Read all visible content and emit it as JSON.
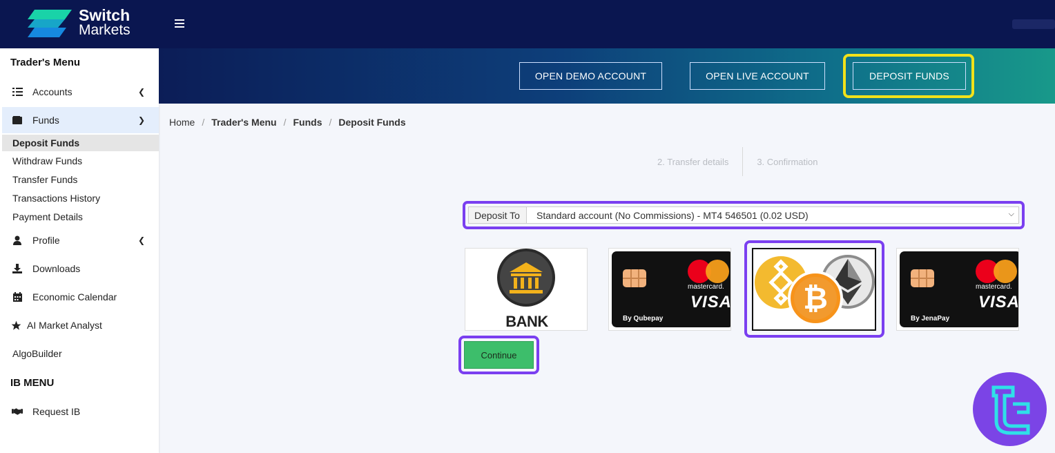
{
  "brand": {
    "line1": "Switch",
    "line2": "Markets",
    "colors": {
      "navy": "#0a1650",
      "accent_purple": "#7a3ff0",
      "highlight_yellow": "#f2e21a",
      "continue_green": "#3dbe6b"
    }
  },
  "sidebar": {
    "heading": "Trader's Menu",
    "accounts": {
      "label": "Accounts",
      "icon": "list-icon"
    },
    "funds": {
      "label": "Funds",
      "icon": "wallet-icon"
    },
    "funds_sub": [
      "Deposit Funds",
      "Withdraw Funds",
      "Transfer Funds",
      "Transactions History",
      "Payment Details"
    ],
    "profile": {
      "label": "Profile",
      "icon": "user-icon"
    },
    "downloads": {
      "label": "Downloads",
      "icon": "download-icon"
    },
    "calendar": {
      "label": "Economic Calendar",
      "icon": "calendar-icon"
    },
    "ai": {
      "label": "AI Market Analyst",
      "icon": "star-icon"
    },
    "algo": {
      "label": "AlgoBuilder"
    },
    "ib_heading": "IB MENU",
    "request_ib": {
      "label": "Request IB",
      "icon": "handshake-icon"
    }
  },
  "banner": {
    "demo": "OPEN DEMO ACCOUNT",
    "live": "OPEN LIVE ACCOUNT",
    "deposit": "DEPOSIT FUNDS"
  },
  "breadcrumb": [
    "Home",
    "Trader's Menu",
    "Funds",
    "Deposit Funds"
  ],
  "steps": [
    "2. Transfer details",
    "3. Confirmation"
  ],
  "deposit": {
    "label": "Deposit To",
    "selected": "Standard account (No Commissions) - MT4 546501 (0.02 USD)"
  },
  "methods": {
    "bank": {
      "label": "BANK TRANSFER"
    },
    "qubepay": {
      "brand": "mastercard.",
      "network": "VISA",
      "by": "By Qubepay"
    },
    "crypto": {
      "coins": [
        "binance-icon",
        "bitcoin-icon",
        "ethereum-icon"
      ]
    },
    "jenapay": {
      "brand": "mastercard.",
      "network": "VISA",
      "by": "By JenaPay"
    }
  },
  "continue_label": "Continue"
}
